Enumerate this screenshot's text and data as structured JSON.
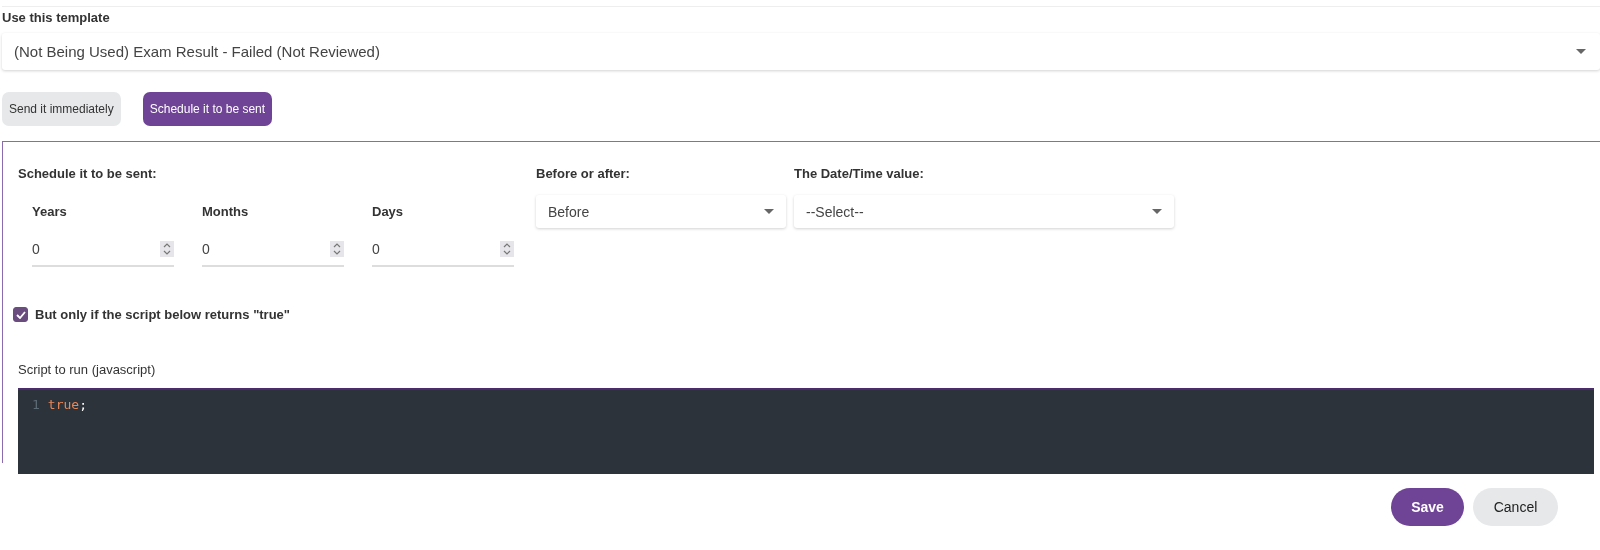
{
  "template": {
    "label": "Use this template",
    "value": "(Not Being Used) Exam Result - Failed (Not Reviewed)"
  },
  "send_modes": [
    {
      "label": "Send it immediately",
      "selected": false
    },
    {
      "label": "Schedule it to be sent",
      "selected": true
    }
  ],
  "schedule": {
    "title": "Schedule it to be sent:",
    "fields": [
      {
        "label": "Years",
        "value": "0"
      },
      {
        "label": "Months",
        "value": "0"
      },
      {
        "label": "Days",
        "value": "0"
      }
    ],
    "before_after": {
      "label": "Before or after:",
      "value": "Before"
    },
    "datetime": {
      "label": "The Date/Time value:",
      "value": "--Select--"
    },
    "condition": {
      "label": "But only if the script below returns \"true\"",
      "checked": true
    },
    "script": {
      "label": "Script to run (javascript)",
      "lines": [
        {
          "number": "1",
          "tokens": [
            {
              "text": "true",
              "kind": "keyword"
            },
            {
              "text": ";",
              "kind": "punct"
            }
          ]
        }
      ]
    }
  },
  "buttons": [
    {
      "label": "Save",
      "kind": "primary"
    },
    {
      "label": "Cancel",
      "kind": "secondary"
    }
  ]
}
